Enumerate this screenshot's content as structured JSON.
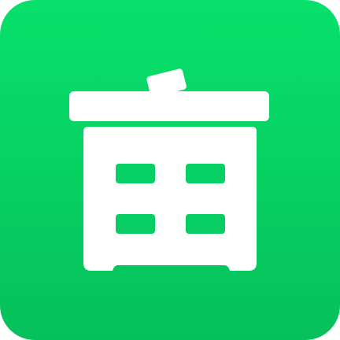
{
  "app_icon": {
    "icon_name": "trash-bin-icon",
    "background_color": "#07d865",
    "glyph_color": "#ffffff"
  }
}
